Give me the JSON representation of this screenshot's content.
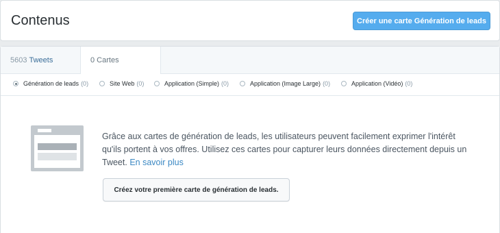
{
  "header": {
    "title": "Contenus",
    "create_button_label": "Créer une carte Génération de leads"
  },
  "tabs": {
    "tweets": {
      "count": "5603",
      "label": "Tweets"
    },
    "cards": {
      "label": "0 Cartes"
    }
  },
  "filters": [
    {
      "label": "Génération de leads",
      "count": "(0)",
      "selected": true
    },
    {
      "label": "Site Web",
      "count": "(0)",
      "selected": false
    },
    {
      "label": "Application (Simple)",
      "count": "(0)",
      "selected": false
    },
    {
      "label": "Application (Image Large)",
      "count": "(0)",
      "selected": false
    },
    {
      "label": "Application (Vidéo)",
      "count": "(0)",
      "selected": false
    }
  ],
  "empty_state": {
    "text": "Grâce aux cartes de génération de leads, les utilisateurs peuvent facilement exprimer l'intérêt qu'ils portent à vos offres. Utilisez ces cartes pour capturer leurs données directement depuis un Tweet.",
    "learn_more": "En savoir plus",
    "button_label": "Créez votre première carte de génération de leads."
  },
  "colors": {
    "accent": "#55acee",
    "link": "#3b88c3"
  }
}
